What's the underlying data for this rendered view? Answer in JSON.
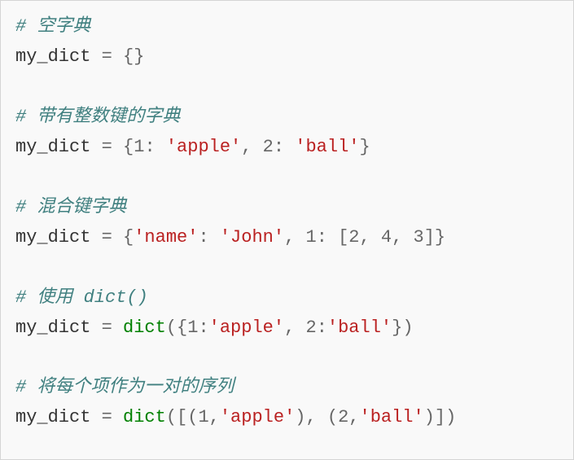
{
  "code": {
    "c1": "# 空字典",
    "l1_var": "my_dict",
    "l1_eq": " = ",
    "l1_br": "{}",
    "c2": "# 带有整数键的字典",
    "l2_var": "my_dict",
    "l2_eq": " = ",
    "l2_lb": "{",
    "l2_k1": "1",
    "l2_col1": ": ",
    "l2_v1": "'apple'",
    "l2_com1": ", ",
    "l2_k2": "2",
    "l2_col2": ": ",
    "l2_v2": "'ball'",
    "l2_rb": "}",
    "c3": "# 混合键字典",
    "l3_var": "my_dict",
    "l3_eq": " = ",
    "l3_lb": "{",
    "l3_k1": "'name'",
    "l3_col1": ": ",
    "l3_v1": "'John'",
    "l3_com1": ", ",
    "l3_k2": "1",
    "l3_col2": ": ",
    "l3_lsb": "[",
    "l3_a1": "2",
    "l3_ac1": ", ",
    "l3_a2": "4",
    "l3_ac2": ", ",
    "l3_a3": "3",
    "l3_rsb": "]",
    "l3_rb": "}",
    "c4": "# 使用 dict()",
    "l4_var": "my_dict",
    "l4_eq": " = ",
    "l4_fn": "dict",
    "l4_lp": "(",
    "l4_lb": "{",
    "l4_k1": "1",
    "l4_col1": ":",
    "l4_v1": "'apple'",
    "l4_com1": ", ",
    "l4_k2": "2",
    "l4_col2": ":",
    "l4_v2": "'ball'",
    "l4_rb": "}",
    "l4_rp": ")",
    "c5": "# 将每个项作为一对的序列",
    "l5_var": "my_dict",
    "l5_eq": " = ",
    "l5_fn": "dict",
    "l5_lp": "(",
    "l5_lsb": "[",
    "l5_t1l": "(",
    "l5_t1a": "1",
    "l5_t1c": ",",
    "l5_t1b": "'apple'",
    "l5_t1r": ")",
    "l5_com1": ", ",
    "l5_t2l": "(",
    "l5_t2a": "2",
    "l5_t2c": ",",
    "l5_t2b": "'ball'",
    "l5_t2r": ")",
    "l5_rsb": "]",
    "l5_rp": ")"
  }
}
